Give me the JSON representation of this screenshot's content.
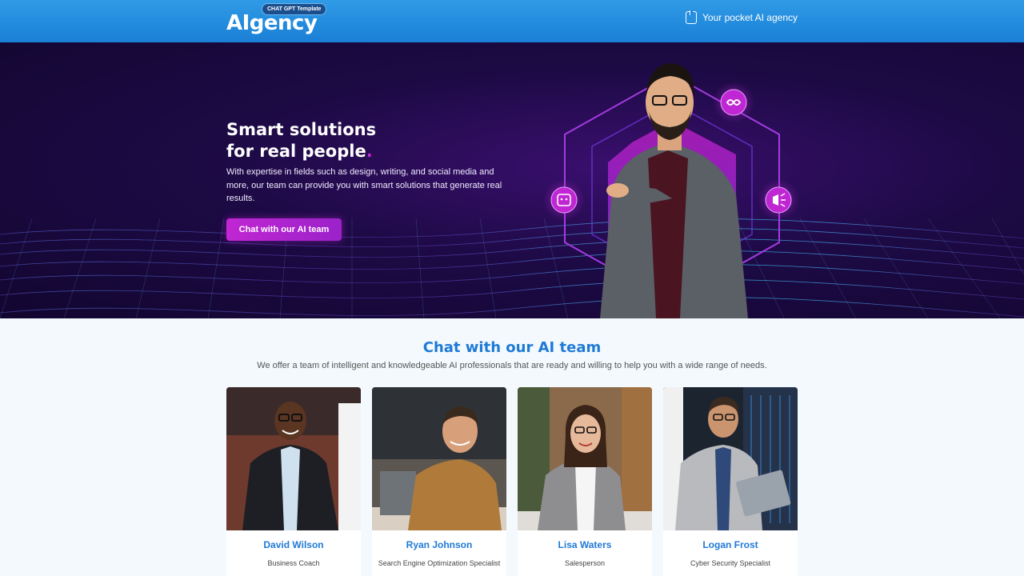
{
  "header": {
    "logo_text": "AIgency",
    "logo_badge": "CHAT GPT Template",
    "tagline": "Your pocket AI agency",
    "tagline_icon": "tablet-icon"
  },
  "hero": {
    "title_line1": "Smart solutions",
    "title_line2": "for real people",
    "title_dot": ".",
    "description": "With expertise in fields such as design, writing, and social media and more, our team can provide you with smart solutions that generate real results.",
    "cta_label": "Chat with our AI team",
    "icons": [
      "infinity-icon",
      "robot-icon",
      "megaphone-icon"
    ]
  },
  "team_section": {
    "title": "Chat with our AI team",
    "subtitle": "We offer a team of intelligent and knowledgeable AI professionals that are ready and willing to help you with a wide range of needs.",
    "members": [
      {
        "name": "David Wilson",
        "role": "Business Coach"
      },
      {
        "name": "Ryan Johnson",
        "role": "Search Engine Optimization Specialist"
      },
      {
        "name": "Lisa Waters",
        "role": "Salesperson"
      },
      {
        "name": "Logan Frost",
        "role": "Cyber Security Specialist"
      }
    ]
  },
  "colors": {
    "brand_blue": "#1f7ad6",
    "accent_purple": "#c026d3",
    "hero_bg": "#1d0a45"
  }
}
